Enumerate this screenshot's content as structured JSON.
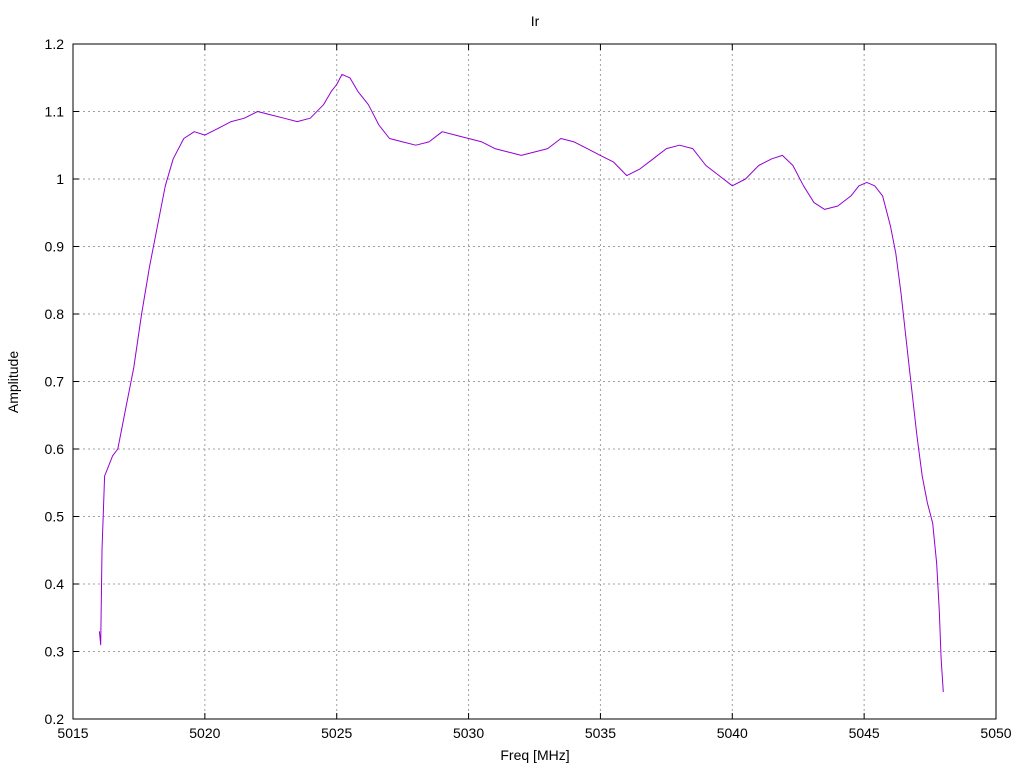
{
  "chart_data": {
    "type": "line",
    "title": "Ir",
    "xlabel": "Freq [MHz]",
    "ylabel": "Amplitude",
    "xlim": [
      5015,
      5050
    ],
    "ylim": [
      0.2,
      1.2
    ],
    "grid": true,
    "x_ticks": [
      "5015",
      "5020",
      "5025",
      "5030",
      "5035",
      "5040",
      "5045",
      "5050"
    ],
    "y_ticks": [
      "0.2",
      "0.3",
      "0.4",
      "0.5",
      "0.6",
      "0.7",
      "0.8",
      "0.9",
      "1",
      "1.1",
      "1.2"
    ],
    "series": [
      {
        "color": "#9400d3",
        "x": [
          5016.0,
          5016.05,
          5016.1,
          5016.2,
          5016.3,
          5016.5,
          5016.7,
          5017.0,
          5017.3,
          5017.6,
          5017.9,
          5018.2,
          5018.5,
          5018.8,
          5019.2,
          5019.6,
          5020.0,
          5020.5,
          5021.0,
          5021.5,
          5022.0,
          5022.5,
          5023.0,
          5023.5,
          5024.0,
          5024.5,
          5024.8,
          5025.0,
          5025.2,
          5025.5,
          5025.8,
          5026.2,
          5026.6,
          5027.0,
          5027.5,
          5028.0,
          5028.5,
          5029.0,
          5029.5,
          5030.0,
          5030.5,
          5031.0,
          5031.5,
          5032.0,
          5032.5,
          5033.0,
          5033.5,
          5034.0,
          5034.5,
          5035.0,
          5035.5,
          5036.0,
          5036.5,
          5037.0,
          5037.5,
          5038.0,
          5038.5,
          5039.0,
          5039.5,
          5040.0,
          5040.5,
          5041.0,
          5041.5,
          5041.9,
          5042.3,
          5042.7,
          5043.1,
          5043.5,
          5044.0,
          5044.5,
          5044.8,
          5045.1,
          5045.4,
          5045.7,
          5046.0,
          5046.2,
          5046.4,
          5046.6,
          5046.8,
          5047.0,
          5047.2,
          5047.4,
          5047.6,
          5047.75,
          5047.85,
          5047.92,
          5048.0
        ],
        "y": [
          0.33,
          0.31,
          0.45,
          0.56,
          0.57,
          0.59,
          0.6,
          0.66,
          0.72,
          0.8,
          0.87,
          0.93,
          0.99,
          1.03,
          1.06,
          1.07,
          1.065,
          1.075,
          1.085,
          1.09,
          1.1,
          1.095,
          1.09,
          1.085,
          1.09,
          1.11,
          1.13,
          1.14,
          1.155,
          1.15,
          1.13,
          1.11,
          1.08,
          1.06,
          1.055,
          1.05,
          1.055,
          1.07,
          1.065,
          1.06,
          1.055,
          1.045,
          1.04,
          1.035,
          1.04,
          1.045,
          1.06,
          1.055,
          1.045,
          1.035,
          1.025,
          1.005,
          1.015,
          1.03,
          1.045,
          1.05,
          1.045,
          1.02,
          1.005,
          0.99,
          1.0,
          1.02,
          1.03,
          1.035,
          1.02,
          0.99,
          0.965,
          0.955,
          0.96,
          0.975,
          0.99,
          0.995,
          0.99,
          0.975,
          0.93,
          0.89,
          0.83,
          0.76,
          0.69,
          0.62,
          0.56,
          0.52,
          0.49,
          0.43,
          0.36,
          0.29,
          0.24
        ]
      }
    ]
  }
}
